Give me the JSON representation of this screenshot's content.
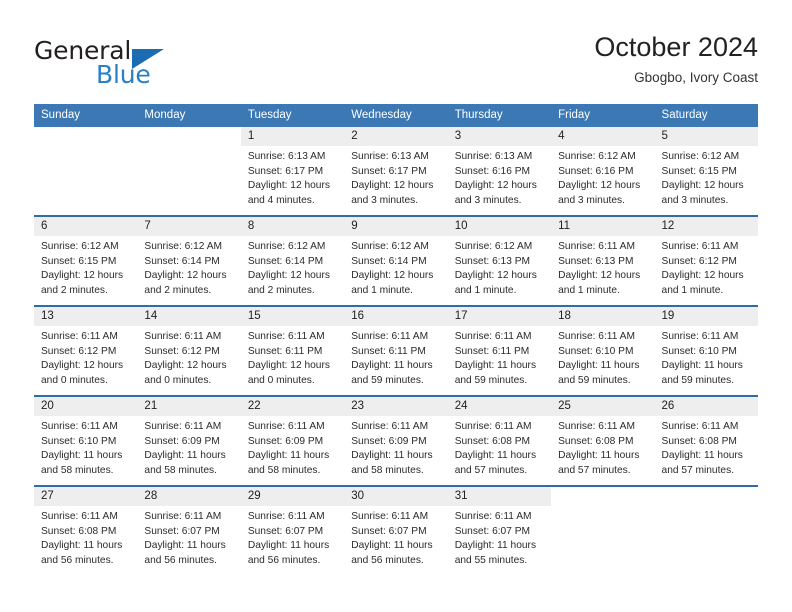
{
  "brand": {
    "word_one": "General",
    "word_two": "Blue",
    "triangle_icon": "brand-triangle-icon",
    "accent_color": "#2b7fc4"
  },
  "header": {
    "title": "October 2024",
    "subtitle": "Gbogbo, Ivory Coast"
  },
  "theme": {
    "header_blue": "#3b78b4",
    "row_rule_blue": "#2f6ca8",
    "daynum_band": "#eeeeee",
    "text": "#2b2b2b"
  },
  "calendar": {
    "weekday_headers": [
      "Sunday",
      "Monday",
      "Tuesday",
      "Wednesday",
      "Thursday",
      "Friday",
      "Saturday"
    ],
    "weeks": [
      {
        "days": [
          {
            "date": "",
            "blank": true
          },
          {
            "date": "",
            "blank": true
          },
          {
            "date": "1",
            "sunrise": "Sunrise: 6:13 AM",
            "sunset": "Sunset: 6:17 PM",
            "daylight": "Daylight: 12 hours and 4 minutes."
          },
          {
            "date": "2",
            "sunrise": "Sunrise: 6:13 AM",
            "sunset": "Sunset: 6:17 PM",
            "daylight": "Daylight: 12 hours and 3 minutes."
          },
          {
            "date": "3",
            "sunrise": "Sunrise: 6:13 AM",
            "sunset": "Sunset: 6:16 PM",
            "daylight": "Daylight: 12 hours and 3 minutes."
          },
          {
            "date": "4",
            "sunrise": "Sunrise: 6:12 AM",
            "sunset": "Sunset: 6:16 PM",
            "daylight": "Daylight: 12 hours and 3 minutes."
          },
          {
            "date": "5",
            "sunrise": "Sunrise: 6:12 AM",
            "sunset": "Sunset: 6:15 PM",
            "daylight": "Daylight: 12 hours and 3 minutes."
          }
        ]
      },
      {
        "days": [
          {
            "date": "6",
            "sunrise": "Sunrise: 6:12 AM",
            "sunset": "Sunset: 6:15 PM",
            "daylight": "Daylight: 12 hours and 2 minutes."
          },
          {
            "date": "7",
            "sunrise": "Sunrise: 6:12 AM",
            "sunset": "Sunset: 6:14 PM",
            "daylight": "Daylight: 12 hours and 2 minutes."
          },
          {
            "date": "8",
            "sunrise": "Sunrise: 6:12 AM",
            "sunset": "Sunset: 6:14 PM",
            "daylight": "Daylight: 12 hours and 2 minutes."
          },
          {
            "date": "9",
            "sunrise": "Sunrise: 6:12 AM",
            "sunset": "Sunset: 6:14 PM",
            "daylight": "Daylight: 12 hours and 1 minute."
          },
          {
            "date": "10",
            "sunrise": "Sunrise: 6:12 AM",
            "sunset": "Sunset: 6:13 PM",
            "daylight": "Daylight: 12 hours and 1 minute."
          },
          {
            "date": "11",
            "sunrise": "Sunrise: 6:11 AM",
            "sunset": "Sunset: 6:13 PM",
            "daylight": "Daylight: 12 hours and 1 minute."
          },
          {
            "date": "12",
            "sunrise": "Sunrise: 6:11 AM",
            "sunset": "Sunset: 6:12 PM",
            "daylight": "Daylight: 12 hours and 1 minute."
          }
        ]
      },
      {
        "days": [
          {
            "date": "13",
            "sunrise": "Sunrise: 6:11 AM",
            "sunset": "Sunset: 6:12 PM",
            "daylight": "Daylight: 12 hours and 0 minutes."
          },
          {
            "date": "14",
            "sunrise": "Sunrise: 6:11 AM",
            "sunset": "Sunset: 6:12 PM",
            "daylight": "Daylight: 12 hours and 0 minutes."
          },
          {
            "date": "15",
            "sunrise": "Sunrise: 6:11 AM",
            "sunset": "Sunset: 6:11 PM",
            "daylight": "Daylight: 12 hours and 0 minutes."
          },
          {
            "date": "16",
            "sunrise": "Sunrise: 6:11 AM",
            "sunset": "Sunset: 6:11 PM",
            "daylight": "Daylight: 11 hours and 59 minutes."
          },
          {
            "date": "17",
            "sunrise": "Sunrise: 6:11 AM",
            "sunset": "Sunset: 6:11 PM",
            "daylight": "Daylight: 11 hours and 59 minutes."
          },
          {
            "date": "18",
            "sunrise": "Sunrise: 6:11 AM",
            "sunset": "Sunset: 6:10 PM",
            "daylight": "Daylight: 11 hours and 59 minutes."
          },
          {
            "date": "19",
            "sunrise": "Sunrise: 6:11 AM",
            "sunset": "Sunset: 6:10 PM",
            "daylight": "Daylight: 11 hours and 59 minutes."
          }
        ]
      },
      {
        "days": [
          {
            "date": "20",
            "sunrise": "Sunrise: 6:11 AM",
            "sunset": "Sunset: 6:10 PM",
            "daylight": "Daylight: 11 hours and 58 minutes."
          },
          {
            "date": "21",
            "sunrise": "Sunrise: 6:11 AM",
            "sunset": "Sunset: 6:09 PM",
            "daylight": "Daylight: 11 hours and 58 minutes."
          },
          {
            "date": "22",
            "sunrise": "Sunrise: 6:11 AM",
            "sunset": "Sunset: 6:09 PM",
            "daylight": "Daylight: 11 hours and 58 minutes."
          },
          {
            "date": "23",
            "sunrise": "Sunrise: 6:11 AM",
            "sunset": "Sunset: 6:09 PM",
            "daylight": "Daylight: 11 hours and 58 minutes."
          },
          {
            "date": "24",
            "sunrise": "Sunrise: 6:11 AM",
            "sunset": "Sunset: 6:08 PM",
            "daylight": "Daylight: 11 hours and 57 minutes."
          },
          {
            "date": "25",
            "sunrise": "Sunrise: 6:11 AM",
            "sunset": "Sunset: 6:08 PM",
            "daylight": "Daylight: 11 hours and 57 minutes."
          },
          {
            "date": "26",
            "sunrise": "Sunrise: 6:11 AM",
            "sunset": "Sunset: 6:08 PM",
            "daylight": "Daylight: 11 hours and 57 minutes."
          }
        ]
      },
      {
        "days": [
          {
            "date": "27",
            "sunrise": "Sunrise: 6:11 AM",
            "sunset": "Sunset: 6:08 PM",
            "daylight": "Daylight: 11 hours and 56 minutes."
          },
          {
            "date": "28",
            "sunrise": "Sunrise: 6:11 AM",
            "sunset": "Sunset: 6:07 PM",
            "daylight": "Daylight: 11 hours and 56 minutes."
          },
          {
            "date": "29",
            "sunrise": "Sunrise: 6:11 AM",
            "sunset": "Sunset: 6:07 PM",
            "daylight": "Daylight: 11 hours and 56 minutes."
          },
          {
            "date": "30",
            "sunrise": "Sunrise: 6:11 AM",
            "sunset": "Sunset: 6:07 PM",
            "daylight": "Daylight: 11 hours and 56 minutes."
          },
          {
            "date": "31",
            "sunrise": "Sunrise: 6:11 AM",
            "sunset": "Sunset: 6:07 PM",
            "daylight": "Daylight: 11 hours and 55 minutes."
          },
          {
            "date": "",
            "blank": true
          },
          {
            "date": "",
            "blank": true
          }
        ]
      }
    ]
  }
}
